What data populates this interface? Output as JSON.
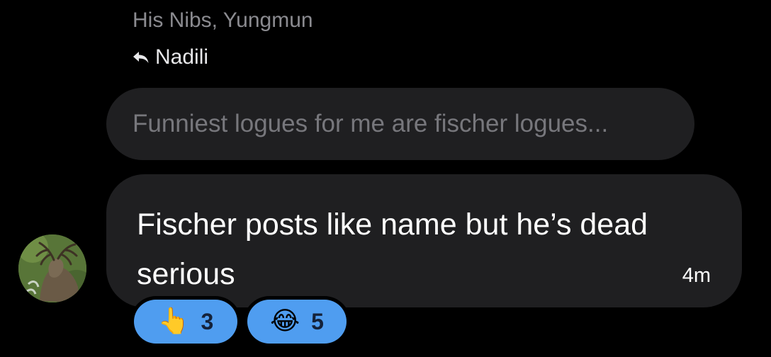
{
  "header": {
    "participants": "His Nibs, Yungmun",
    "reply_to": "Nadili",
    "reply_icon": "reply-arrow-icon"
  },
  "quoted_message": {
    "text": "Funniest logues for me are fischer logues..."
  },
  "message": {
    "text": "Fischer posts like name but he’s dead serious",
    "time": "4m",
    "avatar_icon": "deer-avatar-icon"
  },
  "reactions": [
    {
      "emoji": "👆",
      "icon": "pointing-up-icon",
      "count": "3"
    },
    {
      "emoji": "😂",
      "icon": "tears-of-joy-icon",
      "count": "5"
    }
  ],
  "colors": {
    "background": "#000000",
    "bubble": "#1f1f21",
    "reaction_pill": "#4f9df0",
    "muted_text": "#8b8b90"
  }
}
